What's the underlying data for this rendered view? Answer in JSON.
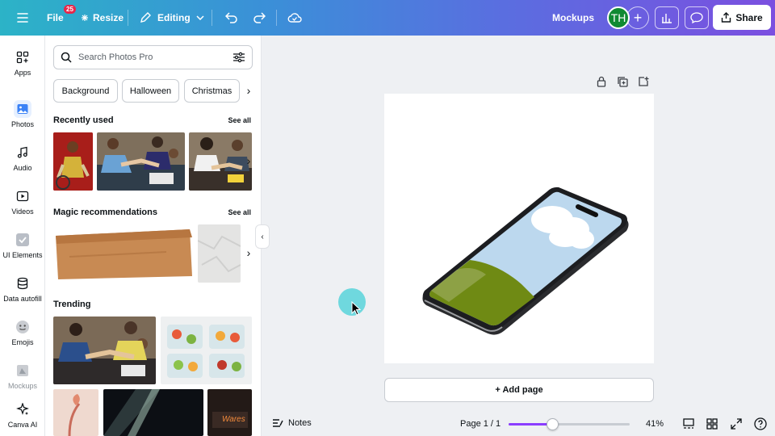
{
  "topbar": {
    "file_label": "File",
    "file_badge": "25",
    "resize_label": "Resize",
    "editing_label": "Editing",
    "mockups_label": "Mockups",
    "avatar_initials": "TH",
    "share_label": "Share"
  },
  "rail": {
    "items": [
      {
        "label": "Apps",
        "icon": "apps-icon"
      },
      {
        "label": "Photos",
        "icon": "photos-icon"
      },
      {
        "label": "Audio",
        "icon": "audio-icon"
      },
      {
        "label": "Videos",
        "icon": "videos-icon"
      },
      {
        "label": "UI Elements",
        "icon": "ui-elements-icon"
      },
      {
        "label": "Data autofill",
        "icon": "data-autofill-icon"
      },
      {
        "label": "Emojis",
        "icon": "emojis-icon"
      },
      {
        "label": "Mockups",
        "icon": "mockups-icon"
      },
      {
        "label": "Canva AI",
        "icon": "canva-ai-icon"
      }
    ]
  },
  "panel": {
    "search_placeholder": "Search Photos Pro",
    "chips": [
      "Background",
      "Halloween",
      "Christmas"
    ],
    "recently_used": "Recently used",
    "magic_recommendations": "Magic recommendations",
    "trending": "Trending",
    "see_all": "See all",
    "trending_thumb_text": "Wares"
  },
  "canvas": {
    "add_page_label": "+ Add page"
  },
  "bottombar": {
    "notes_label": "Notes",
    "page_indicator": "Page 1 / 1",
    "zoom_label": "41%",
    "zoom_fraction": 0.36
  },
  "colors": {
    "accent": "#8b3dff",
    "avatar": "#108a32",
    "badge": "#e8264a",
    "cursor_highlight": "#6fd8de"
  }
}
